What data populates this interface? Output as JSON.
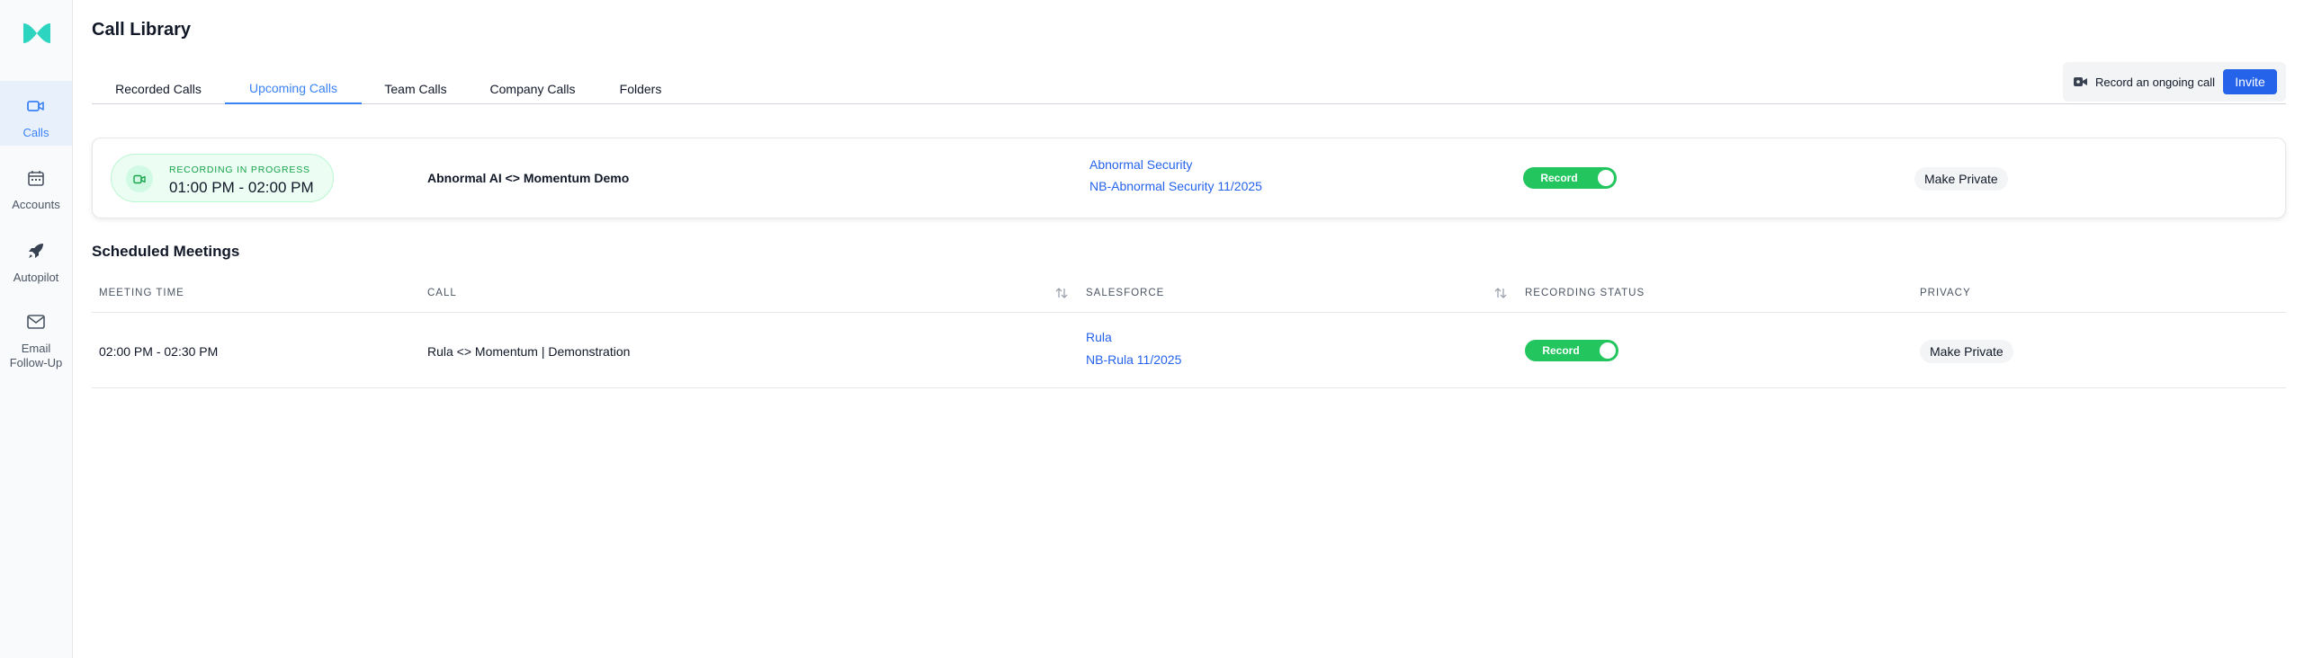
{
  "app": {
    "page_title": "Call Library"
  },
  "sidebar": {
    "items": [
      {
        "label": "Calls",
        "icon": "video-icon"
      },
      {
        "label": "Accounts",
        "icon": "calendar-icon"
      },
      {
        "label": "Autopilot",
        "icon": "rocket-icon"
      },
      {
        "label": "Email\nFollow-Up",
        "icon": "mail-icon"
      }
    ]
  },
  "tabs": [
    {
      "label": "Recorded Calls"
    },
    {
      "label": "Upcoming Calls",
      "active": true
    },
    {
      "label": "Team Calls"
    },
    {
      "label": "Company Calls"
    },
    {
      "label": "Folders"
    }
  ],
  "actions": {
    "record_ongoing_label": "Record an ongoing call",
    "invite_label": "Invite"
  },
  "live": {
    "status": "RECORDING IN PROGRESS",
    "time": "01:00 PM - 02:00 PM",
    "call": "Abnormal AI <> Momentum Demo",
    "account": "Abnormal Security",
    "opportunity": "NB-Abnormal Security 11/2025",
    "record_label": "Record",
    "record_on": true,
    "privacy_label": "Make Private"
  },
  "scheduled": {
    "title": "Scheduled Meetings",
    "headers": {
      "meeting_time": "MEETING TIME",
      "call": "CALL",
      "salesforce": "SALESFORCE",
      "recording_status": "RECORDING STATUS",
      "privacy": "PRIVACY"
    },
    "rows": [
      {
        "time": "02:00 PM - 02:30 PM",
        "call": "Rula <> Momentum | Demonstration",
        "account": "Rula",
        "opportunity": "NB-Rula 11/2025",
        "record_label": "Record",
        "record_on": true,
        "privacy_label": "Make Private"
      }
    ]
  },
  "colors": {
    "accent": "#3b82f6",
    "invite": "#2563eb",
    "toggle_on": "#22c55e",
    "live_green": "#16a34a",
    "brand_teal": "#2dd4bf"
  }
}
